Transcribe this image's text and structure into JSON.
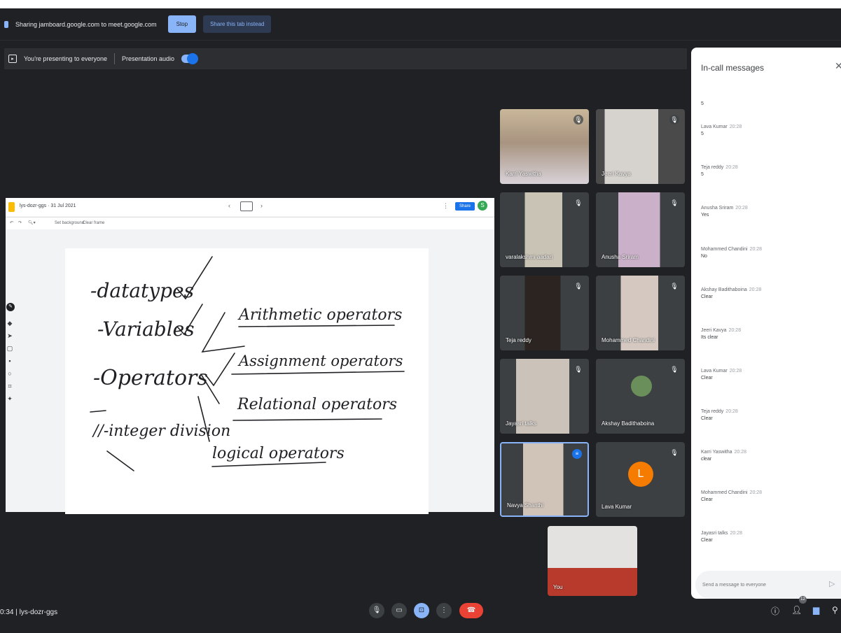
{
  "share_bar": {
    "text": "Sharing jamboard.google.com to meet.google.com",
    "stop": "Stop",
    "share_tab": "Share this tab instead"
  },
  "present_bar": {
    "status": "You're presenting to everyone",
    "audio": "Presentation audio"
  },
  "jamboard": {
    "title": "lys-dozr-ggs · 31 Jul 2021",
    "share": "Share",
    "avatar": "S",
    "set_background": "Set background",
    "clear_frame": "Clear frame",
    "handwriting": [
      "-datatypes",
      "-Variables",
      "-Operators",
      "//-integer division",
      "Arithmetic operators",
      "Assignment operators",
      "Relational operators",
      "logical operators"
    ]
  },
  "participants": [
    {
      "name": "Karri Yaswitha",
      "mic": "off"
    },
    {
      "name": "Jeeri Kavya",
      "mic": "off"
    },
    {
      "name": "varalakshmi aadari",
      "mic": "off"
    },
    {
      "name": "Anusha Sriram",
      "mic": "off"
    },
    {
      "name": "Teja reddy",
      "mic": "off"
    },
    {
      "name": "Mohammed Chandini",
      "mic": "off"
    },
    {
      "name": "Jayasri talks",
      "mic": "off"
    },
    {
      "name": "Akshay Badithaboina",
      "mic": "off"
    },
    {
      "name": "Navya Shanthi",
      "mic": "talking"
    },
    {
      "name": "Lava Kumar",
      "mic": "off",
      "avatar": "L"
    },
    {
      "name": "You",
      "mic": "none"
    }
  ],
  "chat": {
    "title": "In-call messages",
    "first_text": "5",
    "messages": [
      {
        "sender": "Lava Kumar",
        "time": "20:28",
        "text": "5"
      },
      {
        "sender": "Teja reddy",
        "time": "20:28",
        "text": "5"
      },
      {
        "sender": "Anusha Sriram",
        "time": "20:28",
        "text": "Yes"
      },
      {
        "sender": "Mohammed Chandini",
        "time": "20:28",
        "text": "No"
      },
      {
        "sender": "Akshay Badithaboina",
        "time": "20:28",
        "text": "Clear"
      },
      {
        "sender": "Jeeri Kavya",
        "time": "20:28",
        "text": "Its clear"
      },
      {
        "sender": "Lava Kumar",
        "time": "20:28",
        "text": "Clear"
      },
      {
        "sender": "Teja reddy",
        "time": "20:28",
        "text": "Clear"
      },
      {
        "sender": "Karri Yaswitha",
        "time": "20:28",
        "text": "clear"
      },
      {
        "sender": "Mohammed Chandini",
        "time": "20:28",
        "text": "Clear"
      },
      {
        "sender": "Jayasri talks",
        "time": "20:28",
        "text": "Clear"
      }
    ],
    "input_placeholder": "Send a message to everyone"
  },
  "bottom_bar": {
    "meeting_info": "0:34  |  lys-dozr-ggs",
    "people_count": "12"
  }
}
